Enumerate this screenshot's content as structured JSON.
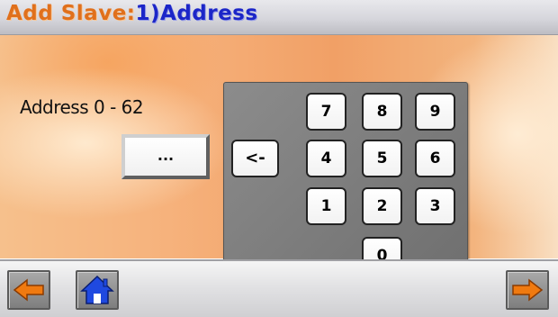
{
  "header": {
    "title_prefix": "Add Slave:",
    "title_suffix": "1)Address"
  },
  "form": {
    "label": "Address 0 - 62",
    "field_value": "..."
  },
  "keypad": {
    "keys": [
      "7",
      "8",
      "9",
      "4",
      "5",
      "6",
      "1",
      "2",
      "3",
      "0"
    ],
    "backspace_label": "<-"
  },
  "footer": {
    "back_icon": "left-arrow-icon",
    "home_icon": "home-icon",
    "next_icon": "right-arrow-icon"
  },
  "colors": {
    "title_orange": "#e0701c",
    "title_blue": "#1c26c8",
    "arrow_orange": "#f07a10",
    "home_blue": "#1f49e0"
  }
}
